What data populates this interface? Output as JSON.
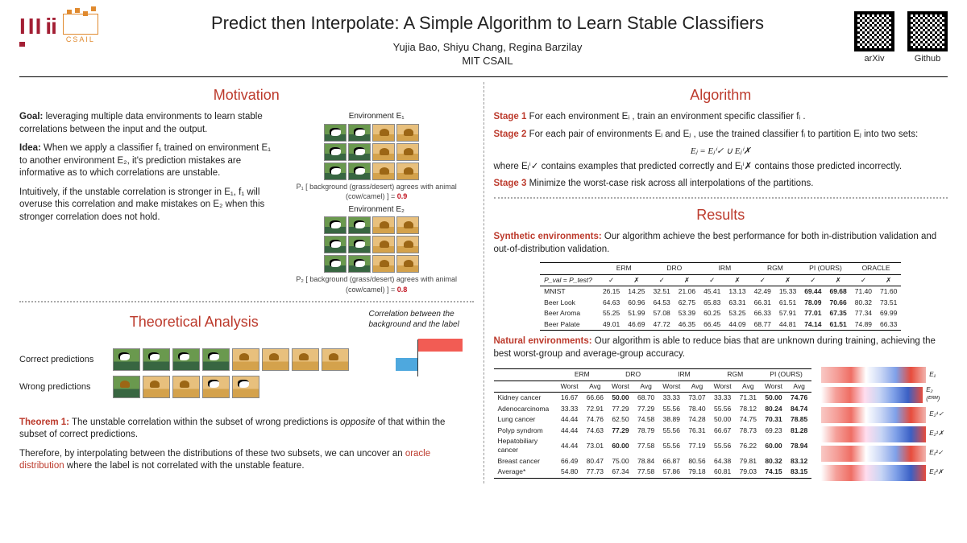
{
  "header": {
    "mit": "MIT",
    "csail": "CSAIL",
    "title": "Predict then Interpolate: A Simple Algorithm to Learn Stable Classifiers",
    "authors": "Yujia Bao, Shiyu Chang, Regina Barzilay",
    "affil": "MIT CSAIL",
    "qr_arxiv": "arXiv",
    "qr_github": "Github"
  },
  "motivation": {
    "heading": "Motivation",
    "goal_label": "Goal:",
    "goal": " leveraging multiple data environments to learn stable correlations between the input and the output.",
    "idea_label": "Idea:",
    "idea": " When we apply a classifier f₁ trained on environment E₁ to another environment E₂, it's prediction mistakes are informative as to which correlations are unstable.",
    "intuit": "Intuitively, if the unstable correlation is stronger in E₁, f₁ will overuse this correlation and make mistakes on E₂ when this stronger correlation does not hold.",
    "env1": "Environment E₁",
    "env2": "Environment E₂",
    "p1_line": "P₁ [ background (grass/desert) agrees with animal (cow/camel) ] =",
    "p1_val": "0.9",
    "p2_line": "P₂ [ background (grass/desert) agrees with animal (cow/camel) ] =",
    "p2_val": "0.8"
  },
  "theory": {
    "heading": "Theoretical Analysis",
    "corr_caption": "Correlation between the background and the label",
    "row_correct": "Correct predictions",
    "row_wrong": "Wrong predictions",
    "thm_label": "Theorem 1:",
    "thm": " The unstable correlation within the subset of wrong predictions is opposite of that within the subset of correct predictions.",
    "therefore": "Therefore, by interpolating between the distributions of these two subsets, we can uncover an ",
    "oracle": "oracle distribution",
    "therefore_tail": " where the label is not correlated with the unstable feature."
  },
  "algorithm": {
    "heading": "Algorithm",
    "s1_label": "Stage 1",
    "s1": " For each environment Eᵢ , train an environment specific classifier fᵢ .",
    "s2_label": "Stage 2",
    "s2": " For each pair of environments Eᵢ and Eⱼ , use the trained classifier fᵢ to partition Eⱼ into two sets:",
    "s2_eq": "Eⱼ = Eⱼⁱ✓ ∪ Eⱼⁱ✗",
    "s2_tail": "where Eⱼⁱ✓ contains examples that  predicted correctly and Eⱼⁱ✗ contains those predicted incorrectly.",
    "s3_label": "Stage 3",
    "s3": " Minimize the worst-case risk across all interpolations of the partitions."
  },
  "results": {
    "heading": "Results",
    "syn_label": "Synthetic environments:",
    "syn": " Our algorithm achieve the best performance for both in-distribution validation and out-of-distribution validation.",
    "nat_label": "Natural environments:",
    "nat": " Our algorithm is able to reduce bias that are unknown during training, achieving the best worst-group and average-group accuracy.",
    "heat_labels": [
      "E₁",
      "E₂   (ᴱᴿᴹ)",
      "E₂¹✓",
      "E₂¹✗",
      "E₁²✓",
      "E₁²✗"
    ]
  },
  "chart_data": [
    {
      "type": "table",
      "title": "Synthetic environments results",
      "columns_top": [
        "",
        "ERM",
        "DRO",
        "IRM",
        "RGM",
        "PI (OURS)",
        "ORACLE"
      ],
      "sub_row_label": "P_val = P_test?",
      "sub_cols": [
        "✓",
        "✗",
        "✓",
        "✗",
        "✓",
        "✗",
        "✓",
        "✗",
        "✓",
        "✗",
        "✓",
        "✗"
      ],
      "rows": [
        {
          "name": "MNIST",
          "vals": [
            26.15,
            14.25,
            32.51,
            21.06,
            45.41,
            13.13,
            42.49,
            15.33,
            69.44,
            69.68,
            71.4,
            71.6
          ],
          "bold": [
            8,
            9
          ]
        },
        {
          "name": "Beer Look",
          "vals": [
            64.63,
            60.96,
            64.53,
            62.75,
            65.83,
            63.31,
            66.31,
            61.51,
            78.09,
            70.66,
            80.32,
            73.51
          ],
          "bold": [
            8,
            9
          ]
        },
        {
          "name": "Beer Aroma",
          "vals": [
            55.25,
            51.99,
            57.08,
            53.39,
            60.25,
            53.25,
            66.33,
            57.91,
            77.01,
            67.35,
            77.34,
            69.99
          ],
          "bold": [
            8,
            9
          ]
        },
        {
          "name": "Beer Palate",
          "vals": [
            49.01,
            46.69,
            47.72,
            46.35,
            66.45,
            44.09,
            68.77,
            44.81,
            74.14,
            61.51,
            74.89,
            66.33
          ],
          "bold": [
            8,
            9
          ]
        }
      ]
    },
    {
      "type": "table",
      "title": "Natural environments results",
      "columns_top": [
        "",
        "ERM",
        "DRO",
        "IRM",
        "RGM",
        "PI (OURS)"
      ],
      "sub_cols": [
        "Worst",
        "Avg",
        "Worst",
        "Avg",
        "Worst",
        "Avg",
        "Worst",
        "Avg",
        "Worst",
        "Avg"
      ],
      "rows": [
        {
          "name": "Kidney cancer",
          "vals": [
            16.67,
            66.66,
            50.0,
            68.7,
            33.33,
            73.07,
            33.33,
            71.31,
            50.0,
            74.76
          ],
          "bold": [
            2,
            8,
            9
          ]
        },
        {
          "name": "Adenocarcinoma",
          "vals": [
            33.33,
            72.91,
            77.29,
            77.29,
            55.56,
            78.4,
            55.56,
            78.12,
            80.24,
            84.74
          ],
          "bold": [
            8,
            9
          ]
        },
        {
          "name": "Lung cancer",
          "vals": [
            44.44,
            74.76,
            62.5,
            74.58,
            38.89,
            74.28,
            50.0,
            74.75,
            70.31,
            78.85
          ],
          "bold": [
            8,
            9
          ]
        },
        {
          "name": "Polyp syndrom",
          "vals": [
            44.44,
            74.63,
            77.29,
            78.79,
            55.56,
            76.31,
            66.67,
            78.73,
            69.23,
            81.28
          ],
          "bold": [
            2,
            9
          ]
        },
        {
          "name": "Hepatobiliary cancer",
          "vals": [
            44.44,
            73.01,
            60.0,
            77.58,
            55.56,
            77.19,
            55.56,
            76.22,
            60.0,
            78.94
          ],
          "bold": [
            2,
            8,
            9
          ]
        },
        {
          "name": "Breast cancer",
          "vals": [
            66.49,
            80.47,
            75.0,
            78.84,
            66.87,
            80.56,
            64.38,
            79.81,
            80.32,
            83.12
          ],
          "bold": [
            8,
            9
          ]
        },
        {
          "name": "Average*",
          "vals": [
            54.8,
            77.73,
            67.34,
            77.58,
            57.86,
            79.18,
            60.81,
            79.03,
            74.15,
            83.15
          ],
          "bold": [
            8,
            9
          ]
        }
      ]
    },
    {
      "type": "bar",
      "title": "Correlation between the background and the label",
      "categories": [
        "Correct predictions",
        "Wrong predictions"
      ],
      "values": [
        0.55,
        -0.28
      ],
      "xlabel": "",
      "ylabel": "",
      "ylim": [
        -1,
        1
      ]
    }
  ]
}
